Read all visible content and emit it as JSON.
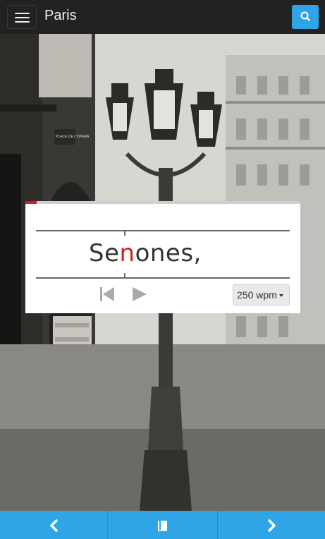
{
  "header": {
    "title": "Paris",
    "menu_icon": "hamburger-menu-icon",
    "search_icon": "search-icon",
    "accent_color": "#2fa4e7"
  },
  "background": {
    "image": "Sepia street scene: ornate cast-iron triple lamp post before Parisian buildings",
    "sign_text": "PLACE DE L'OPERA"
  },
  "reader": {
    "progress": 0.04,
    "word_prefix": "Se",
    "word_pivot": "n",
    "word_suffix": "ones,",
    "pivot_color": "#cc1f1f",
    "controls": {
      "back_icon": "skip-back-icon",
      "play_icon": "play-icon"
    },
    "speed": {
      "label": "250 wpm",
      "icon": "caret-down-icon"
    }
  },
  "bottom_nav": {
    "prev_icon": "chevron-left-icon",
    "book_icon": "book-icon",
    "next_icon": "chevron-right-icon"
  }
}
